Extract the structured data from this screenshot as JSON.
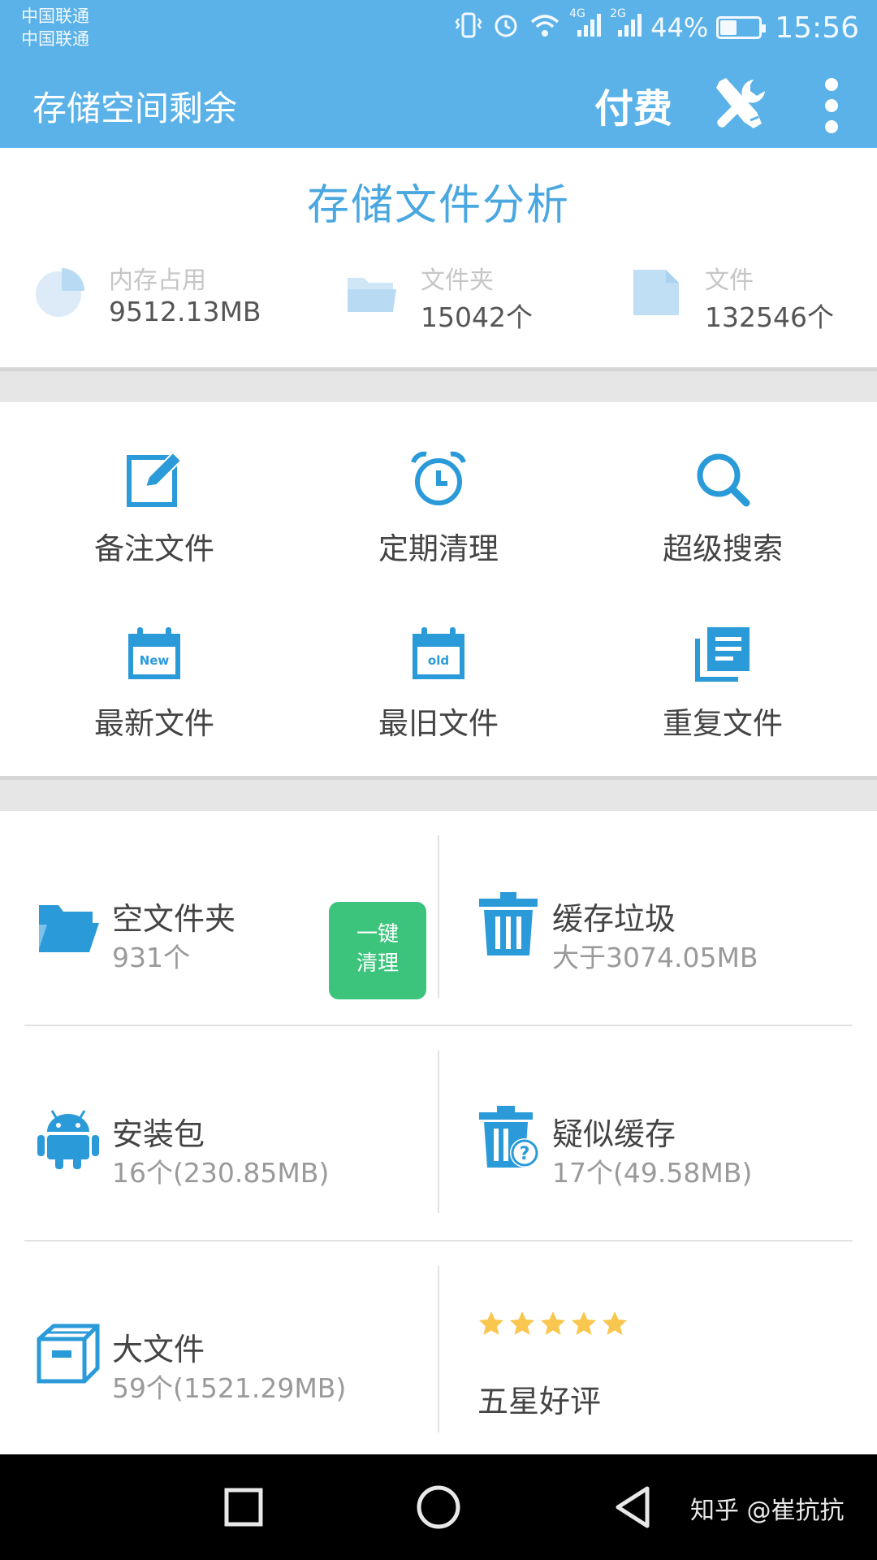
{
  "status_bar": {
    "carrier_1": "中国联通",
    "carrier_2": "中国联通",
    "net_4g": "4G",
    "net_2g": "2G",
    "battery": "44%",
    "battery_level": 0.44,
    "time": "15:56"
  },
  "app_bar": {
    "title": "存储空间剩余",
    "pay_label": "付费"
  },
  "analysis": {
    "title": "存储文件分析",
    "stats": [
      {
        "label": "内存占用",
        "value": "9512.13MB",
        "icon": "pie-chart-icon"
      },
      {
        "label": "文件夹",
        "value": "15042个",
        "icon": "folder-icon"
      },
      {
        "label": "文件",
        "value": "132546个",
        "icon": "file-icon"
      }
    ]
  },
  "tools": [
    {
      "label": "备注文件",
      "icon": "edit-note-icon"
    },
    {
      "label": "定期清理",
      "icon": "alarm-clock-icon"
    },
    {
      "label": "超级搜索",
      "icon": "search-icon"
    },
    {
      "label": "最新文件",
      "icon": "calendar-new-icon",
      "badge": "New"
    },
    {
      "label": "最旧文件",
      "icon": "calendar-old-icon",
      "badge": "old"
    },
    {
      "label": "重复文件",
      "icon": "duplicate-files-icon"
    }
  ],
  "cleaning": {
    "empty_folders": {
      "title": "空文件夹",
      "sub": "931个",
      "button_line1": "一键",
      "button_line2": "清理"
    },
    "cache_junk": {
      "title": "缓存垃圾",
      "sub": "大于3074.05MB"
    },
    "apk": {
      "title": "安装包",
      "sub": "16个(230.85MB)"
    },
    "suspect_cache": {
      "title": "疑似缓存",
      "sub": "17个(49.58MB)"
    },
    "big_files": {
      "title": "大文件",
      "sub": "59个(1521.29MB)"
    },
    "rating": {
      "label": "五星好评",
      "stars": 5
    }
  },
  "nav_bar": {
    "watermark": "知乎 @崔抗抗"
  },
  "colors": {
    "primary": "#5bb2e8",
    "icon_blue": "#2a9ad8",
    "green": "#3cc47c",
    "star": "#f9c74f"
  }
}
